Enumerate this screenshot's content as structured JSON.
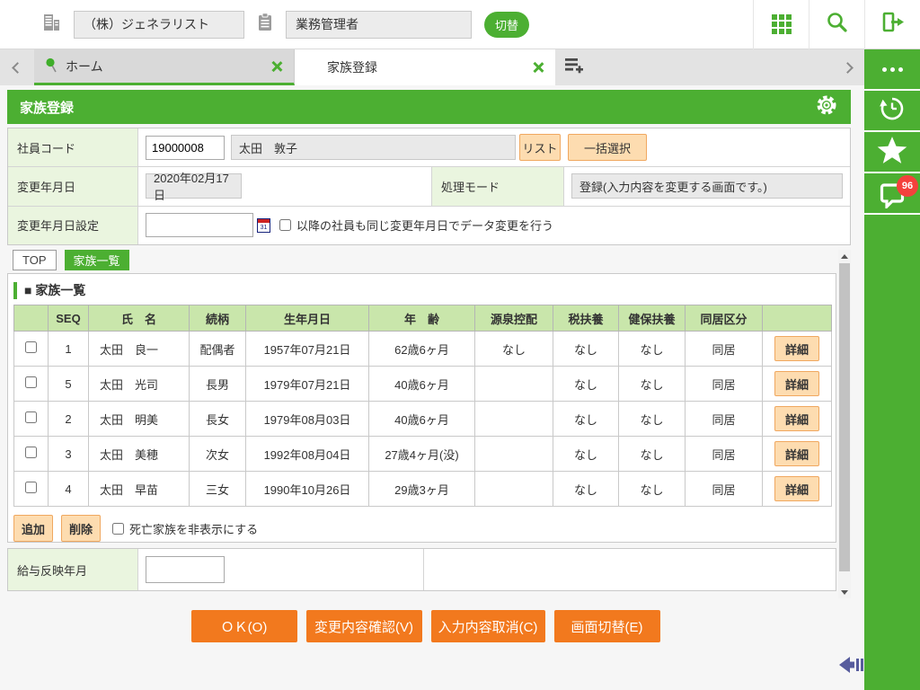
{
  "header": {
    "company": "（株）ジェネラリスト",
    "role": "業務管理者",
    "switch_button": "切替"
  },
  "tab_bar": {
    "home_tab": "ホーム",
    "active_tab": "家族登録"
  },
  "page": {
    "title": "家族登録"
  },
  "form": {
    "employee_code_label": "社員コード",
    "employee_code_value": "19000008",
    "employee_name": "太田　敦子",
    "list_button": "リスト",
    "bulk_select_button": "一括選択",
    "change_date_label": "変更年月日",
    "change_date_value": "2020年02月17日",
    "process_mode_label": "処理モード",
    "process_mode_value": "登録(入力内容を変更する画面です。)",
    "change_date_setting_label": "変更年月日設定",
    "change_date_setting_value": "",
    "calendar_icon_label": "31",
    "apply_same_date_checkbox": "以降の社員も同じ変更年月日でデータ変更を行う"
  },
  "subtabs": {
    "top": "TOP",
    "family_list": "家族一覧"
  },
  "family_section": {
    "title": "■ 家族一覧",
    "headers": [
      "",
      "SEQ",
      "氏　名",
      "続柄",
      "生年月日",
      "年　齢",
      "源泉控配",
      "税扶養",
      "健保扶養",
      "同居区分",
      ""
    ],
    "rows": [
      {
        "seq": "1",
        "name": "太田　良一",
        "relation": "配偶者",
        "birth": "1957年07月21日",
        "age": "62歳6ヶ月",
        "withholding": "なし",
        "tax_dependent": "なし",
        "health_dependent": "なし",
        "living": "同居",
        "detail": "詳細"
      },
      {
        "seq": "5",
        "name": "太田　光司",
        "relation": "長男",
        "birth": "1979年07月21日",
        "age": "40歳6ヶ月",
        "withholding": "",
        "tax_dependent": "なし",
        "health_dependent": "なし",
        "living": "同居",
        "detail": "詳細"
      },
      {
        "seq": "2",
        "name": "太田　明美",
        "relation": "長女",
        "birth": "1979年08月03日",
        "age": "40歳6ヶ月",
        "withholding": "",
        "tax_dependent": "なし",
        "health_dependent": "なし",
        "living": "同居",
        "detail": "詳細"
      },
      {
        "seq": "3",
        "name": "太田　美穂",
        "relation": "次女",
        "birth": "1992年08月04日",
        "age": "27歳4ヶ月(没)",
        "withholding": "",
        "tax_dependent": "なし",
        "health_dependent": "なし",
        "living": "同居",
        "detail": "詳細"
      },
      {
        "seq": "4",
        "name": "太田　早苗",
        "relation": "三女",
        "birth": "1990年10月26日",
        "age": "29歳3ヶ月",
        "withholding": "",
        "tax_dependent": "なし",
        "health_dependent": "なし",
        "living": "同居",
        "detail": "詳細"
      }
    ],
    "add_button": "追加",
    "delete_button": "削除",
    "hide_deceased_checkbox": "死亡家族を非表示にする"
  },
  "salary_row": {
    "label": "給与反映年月",
    "value": ""
  },
  "footer_buttons": {
    "ok": "ＯＫ(O)",
    "confirm_changes": "変更内容確認(V)",
    "cancel_input": "入力内容取消(C)",
    "switch_screen": "画面切替(E)"
  },
  "sidebar": {
    "badge_count": "96"
  },
  "icons": {
    "header": [
      "building-icon",
      "clipboard-icon",
      "grid-icon",
      "search-icon",
      "logout-icon"
    ],
    "tab_bar": [
      "scroll-left-icon",
      "pin-icon",
      "close-icon",
      "new-tab-icon",
      "scroll-right-icon"
    ],
    "title_bar": [
      "gear-icon"
    ],
    "form": [
      "calendar-icon"
    ],
    "sidebar": [
      "more-icon",
      "history-icon",
      "star-icon",
      "chat-icon"
    ],
    "misc": [
      "collapse-arrow-icon",
      "scroll-up-icon",
      "scroll-down-icon"
    ]
  },
  "colors": {
    "green": "#4caf32",
    "table_header_green": "#c9e6ab",
    "label_green": "#eaf5df",
    "orange": "#f2791e",
    "peach": "#fddcb0",
    "badge_red": "#f4413c",
    "collapse_purple": "#575c9d"
  }
}
